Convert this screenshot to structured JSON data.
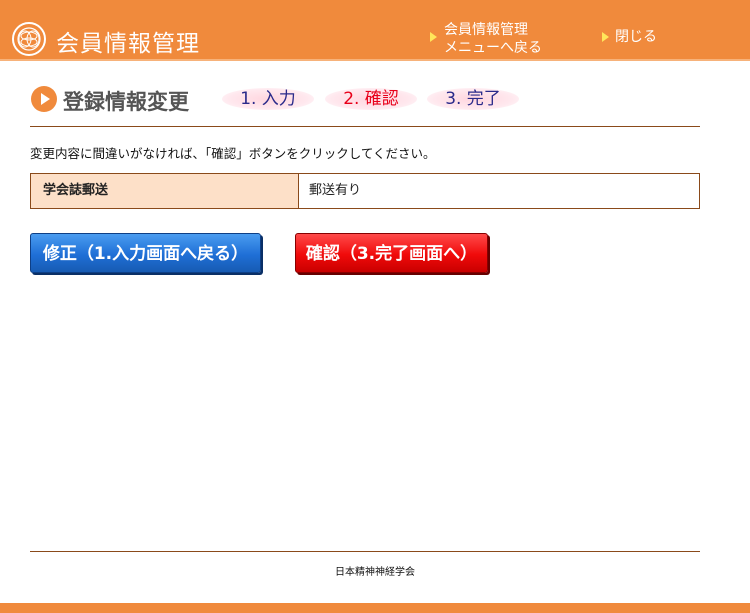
{
  "header": {
    "app_title": "会員情報管理",
    "nav_menu_line1": "会員情報管理",
    "nav_menu_line2": "メニューへ戻る",
    "nav_close": "閉じる",
    "logo_icon": "society-logo-icon",
    "accent_color": "#f08a3c"
  },
  "page": {
    "title": "登録情報変更",
    "steps": [
      {
        "label": "1. 入力",
        "active": false
      },
      {
        "label": "2. 確認",
        "active": true
      },
      {
        "label": "3. 完了",
        "active": false
      }
    ],
    "instruction": "変更内容に間違いがなければ、「確認」ボタンをクリックしてください。"
  },
  "table": {
    "rows": [
      {
        "label": "学会誌郵送",
        "value": "郵送有り"
      }
    ]
  },
  "buttons": {
    "edit_label": "修正（1.入力画面へ戻る）",
    "confirm_label": "確認（3.完了画面へ）"
  },
  "footer": {
    "text": "日本精神神経学会"
  }
}
